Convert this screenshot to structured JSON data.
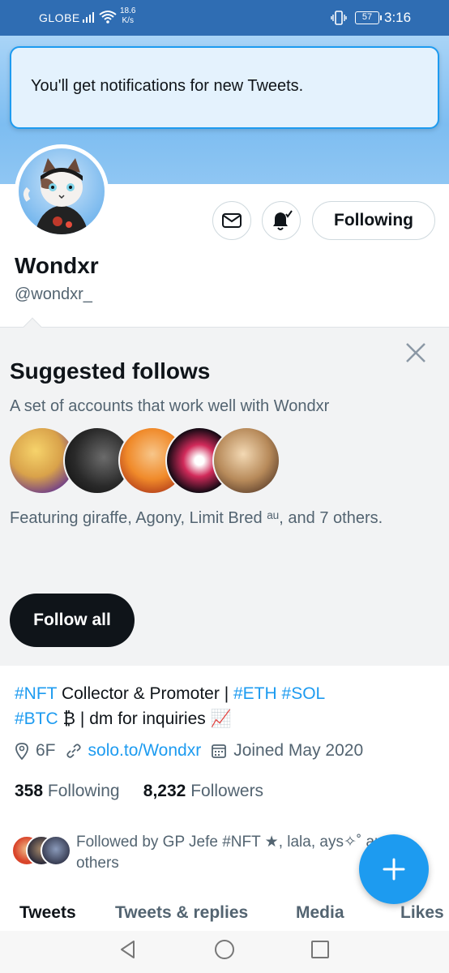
{
  "status_bar": {
    "carrier": "GLOBE",
    "speed_value": "18.6",
    "speed_unit": "K/s",
    "battery": "57",
    "time": "3:16"
  },
  "toast": {
    "message": "You'll get notifications for new Tweets."
  },
  "profile": {
    "name": "Wondxr",
    "handle": "@wondxr_",
    "following_button": "Following"
  },
  "suggested": {
    "title": "Suggested follows",
    "subtitle": "A set of accounts that work well with Wondxr",
    "featuring": "Featuring giraffe, Agony, Limit Bred ᵃᵘ, and 7 others.",
    "follow_all": "Follow all"
  },
  "bio": {
    "line1_tag1": "#NFT",
    "line1_text": " Collector & Promoter | ",
    "line1_tag2": "#ETH",
    "line1_sp": " ",
    "line1_tag3": "#SOL",
    "line2_tag": "#BTC",
    "line2_text": " ₿ | dm for inquiries 📈"
  },
  "meta": {
    "location": "6F",
    "link": "solo.to/Wondxr",
    "joined": "Joined May 2020"
  },
  "counts": {
    "following_num": "358",
    "following_label": "Following",
    "followers_num": "8,232",
    "followers_label": "Followers"
  },
  "followed_by": {
    "text": "Followed by GP Jefe #NFT ★, lala, ays✧˚ and 3 others"
  },
  "tabs": [
    "Tweets",
    "Tweets & replies",
    "Media",
    "Likes"
  ],
  "colors": {
    "accent": "#1d9bf0",
    "status_bar": "#2f6db3",
    "text": "#0f1419",
    "muted": "#536471"
  }
}
